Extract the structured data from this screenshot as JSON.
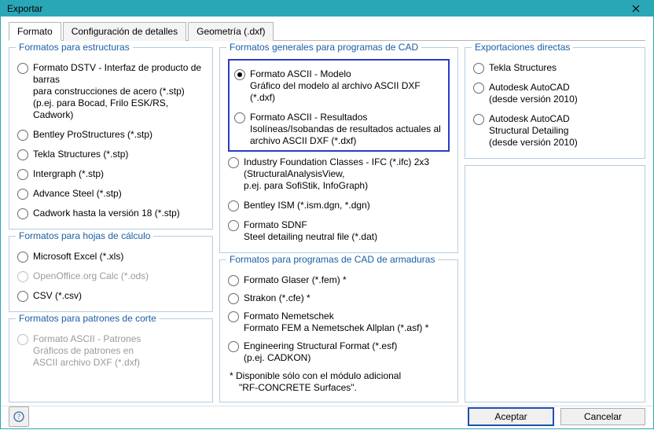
{
  "window": {
    "title": "Exportar"
  },
  "tabs": {
    "t0": "Formato",
    "t1": "Configuración de detalles",
    "t2": "Geometría (.dxf)"
  },
  "col1": {
    "g1": {
      "title": "Formatos para estructuras",
      "r0a": "Formato DSTV - Interfaz de producto de barras",
      "r0b": "para construcciones de acero (*.stp)",
      "r0c": "(p.ej. para Bocad, Frilo ESK/RS, Cadwork)",
      "r1": "Bentley ProStructures (*.stp)",
      "r2": "Tekla Structures (*.stp)",
      "r3": "Intergraph (*.stp)",
      "r4": "Advance Steel (*.stp)",
      "r5": "Cadwork hasta la versión 18 (*.stp)"
    },
    "g2": {
      "title": "Formatos para hojas de cálculo",
      "r0": "Microsoft Excel (*.xls)",
      "r1": "OpenOffice.org Calc (*.ods)",
      "r2": "CSV (*.csv)"
    },
    "g3": {
      "title": "Formatos para patrones de corte",
      "r0a": "Formato ASCII - Patrones",
      "r0b": "Gráficos de patrones en",
      "r0c": "ASCII archivo DXF (*.dxf)"
    }
  },
  "col2": {
    "g1": {
      "title": "Formatos generales para programas de CAD",
      "r0a": "Formato ASCII - Modelo",
      "r0b": "Gráfico del modelo al archivo ASCII DXF (*.dxf)",
      "r1a": "Formato ASCII - Resultados",
      "r1b": "Isolíneas/Isobandas de resultados actuales al",
      "r1c": "archivo ASCII DXF (*.dxf)",
      "r2a": "Industry Foundation Classes - IFC (*.ifc) 2x3",
      "r2b": "(StructuralAnalysisView,",
      "r2c": "p.ej. para SofiStik, InfoGraph)",
      "r3": "Bentley ISM (*.ism.dgn, *.dgn)",
      "r4a": "Formato SDNF",
      "r4b": "Steel detailing neutral file (*.dat)"
    },
    "g2": {
      "title": "Formatos para programas de CAD de armaduras",
      "r0": "Formato Glaser (*.fem)  *",
      "r1": "Strakon (*.cfe)  *",
      "r2a": "Formato Nemetschek",
      "r2b": "Formato FEM a Nemetschek Allplan (*.asf)  *",
      "r3a": "Engineering Structural Format (*.esf)",
      "r3b": "(p.ej. CADKON)",
      "noteA": "*  Disponible sólo con el módulo adicional",
      "noteB": "\"RF-CONCRETE Surfaces\"."
    }
  },
  "col3": {
    "g1": {
      "title": "Exportaciones directas",
      "r0": "Tekla Structures",
      "r1a": "Autodesk AutoCAD",
      "r1b": "(desde versión 2010)",
      "r2a": "Autodesk AutoCAD",
      "r2b": "Structural Detailing",
      "r2c": "(desde versión 2010)"
    }
  },
  "footer": {
    "ok": "Aceptar",
    "cancel": "Cancelar"
  }
}
